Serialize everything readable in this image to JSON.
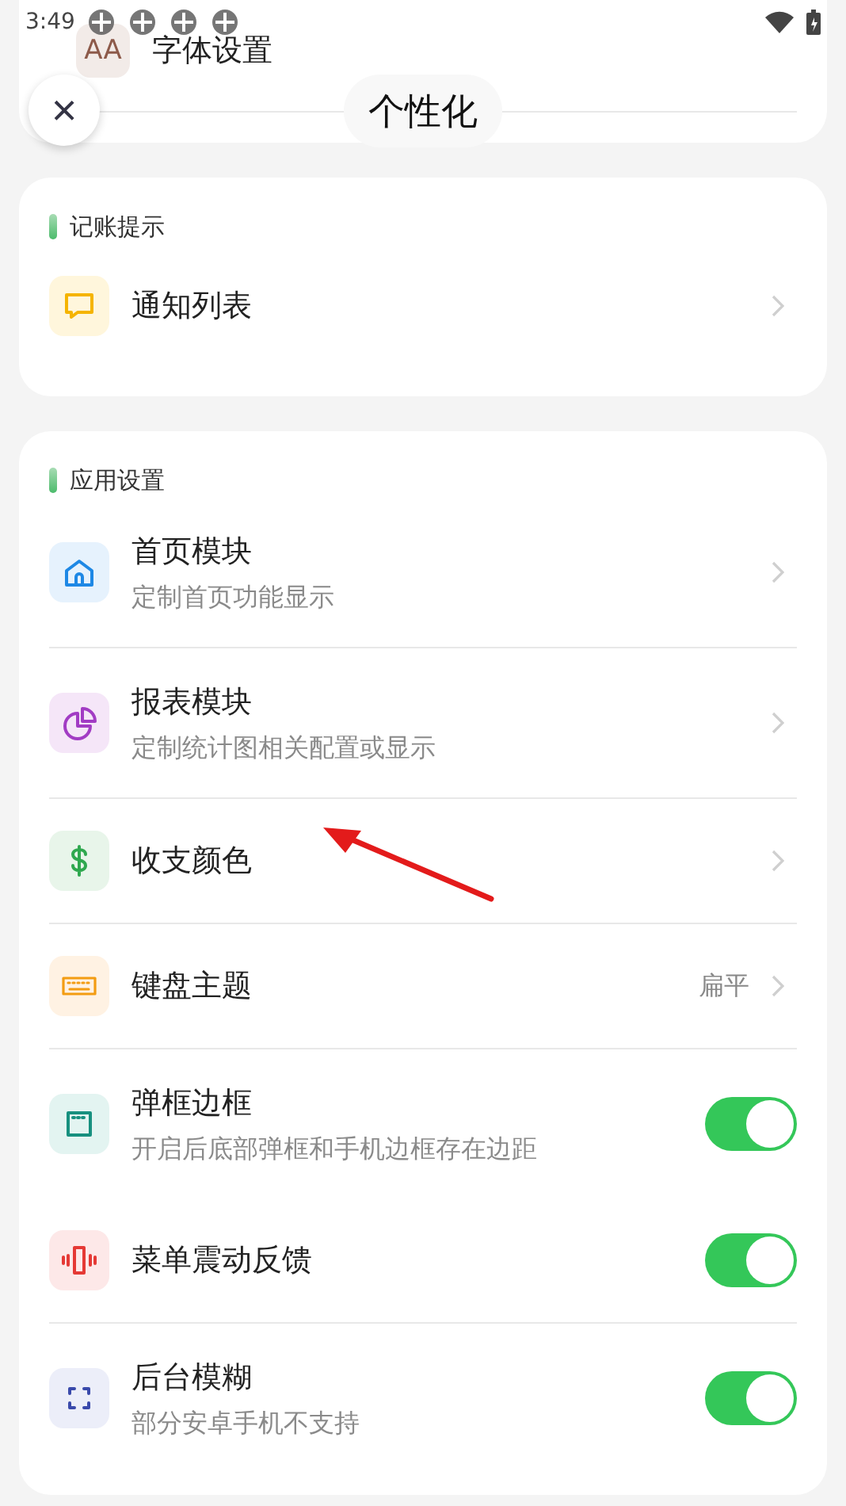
{
  "status_bar": {
    "time": "3:49"
  },
  "header": {
    "close": "×",
    "title": "个性化"
  },
  "top_row": {
    "icon_text": "AA",
    "label": "字体设置"
  },
  "sections": [
    {
      "title": "记账提示",
      "rows": [
        {
          "kind": "link",
          "label": "通知列表",
          "divider": false
        }
      ]
    },
    {
      "title": "应用设置",
      "rows": [
        {
          "kind": "link",
          "label": "首页模块",
          "subtitle": "定制首页功能显示",
          "divider": true
        },
        {
          "kind": "link",
          "label": "报表模块",
          "subtitle": "定制统计图相关配置或显示",
          "divider": true
        },
        {
          "kind": "link",
          "label": "收支颜色",
          "divider": true
        },
        {
          "kind": "link",
          "label": "键盘主题",
          "value": "扁平",
          "divider": true
        },
        {
          "kind": "switch",
          "label": "弹框边框",
          "subtitle": "开启后底部弹框和手机边框存在边距",
          "on": true,
          "divider": false
        },
        {
          "kind": "switch",
          "label": "菜单震动反馈",
          "on": true,
          "divider": true
        },
        {
          "kind": "switch",
          "label": "后台模糊",
          "subtitle": "部分安卓手机不支持",
          "on": true,
          "divider": false
        }
      ]
    }
  ]
}
